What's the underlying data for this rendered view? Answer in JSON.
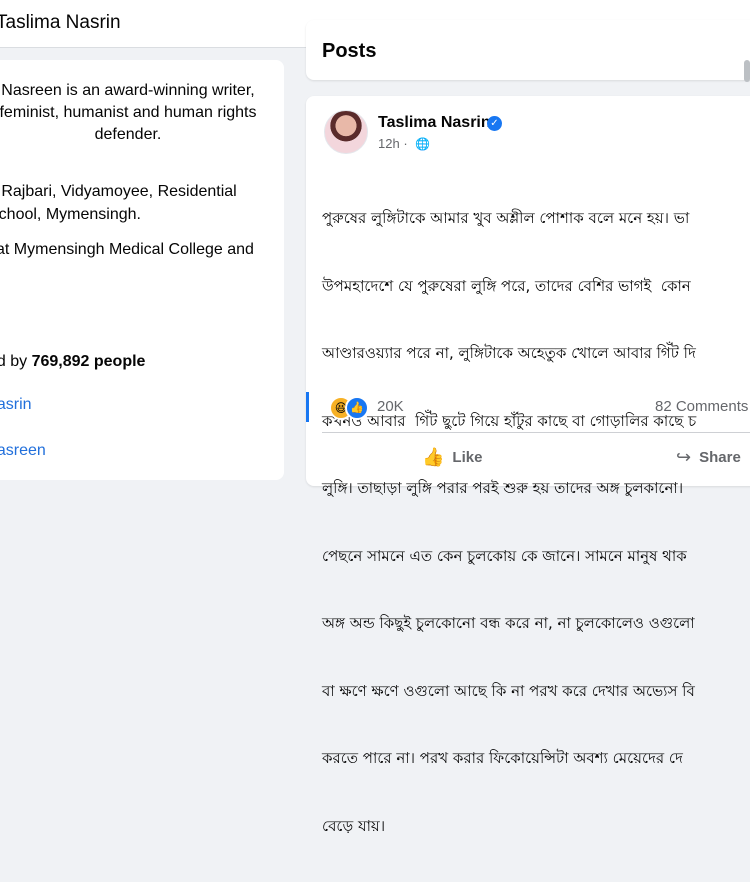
{
  "header": {
    "title": "Taslima Nasrin"
  },
  "intro": {
    "bio": "Taslima Nasreen is an award-winning writer, physician, secularist, feminist, humanist and human rights defender.",
    "bio_lines": [
      "Nasreen is an award-winning writer,",
      "feminist, humanist and human rights",
      "defender."
    ],
    "education_1": "o Rajbari, Vidyamoyee, Residential\nSchool, Mymensingh.",
    "education_2": "l at Mymensingh Medical College and\nal",
    "followers_prefix": "ed by",
    "followers_count": "769,892 people",
    "link_1": "nasrin",
    "link_2": "nasreen"
  },
  "posts": {
    "section_title": "Posts"
  },
  "post": {
    "author": "Taslima Nasrin",
    "time": "12h",
    "privacy_icon": "globe-icon",
    "text_lines": [
      "পুরুষের লুঙ্গিটাকে আমার খুব অশ্লীল পোশাক বলে মনে হয়। ভা",
      "উপমহাদেশে যে পুরুষেরা লুঙ্গি পরে, তাদের বেশির ভাগই  কোন",
      "আণ্ডারওয়্যার পরে না, লুঙ্গিটাকে অহেতুক খোলে আবার গিঁট দি",
      "কখনও আবার  গিঁট ছুটে গিয়ে হাঁটুর কাছে বা গোড়ালির কাছে চ",
      "লুঙ্গি। তাছাড়া লুঙ্গি পরার পরই শুরু হয় তাদের অঙ্গ চুলকানো।",
      "পেছনে সামনে এত কেন চুলকোয় কে জানে। সামনে মানুষ থাক",
      "অঙ্গ অন্ড কিছুই চুলকোনো বন্ধ করে না, না চুলকোলেও ওগুলো",
      "বা ক্ষণে ক্ষণে ওগুলো আছে কি না পরখ করে দেখার অভ্যেস বি",
      "করতে পারে না। পরখ করার ফিকোয়েন্সিটা অবশ্য মেয়েদের দে",
      "বেড়ে যায়।"
    ],
    "reactions": {
      "icons": [
        "haha-icon",
        "like-icon"
      ],
      "count": "20K"
    },
    "comments": "82 Comments",
    "actions": {
      "like": "Like",
      "share": "Share"
    }
  },
  "colors": {
    "accent": "#1877f2",
    "link": "#216fdb",
    "muted": "#65676b"
  }
}
